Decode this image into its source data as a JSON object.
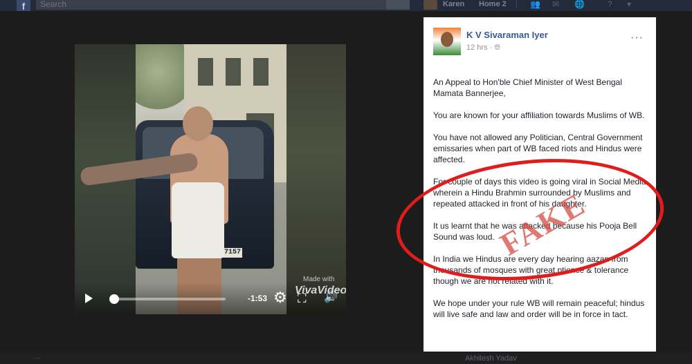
{
  "topbar": {
    "search_placeholder": "Search",
    "user_name": "Karen",
    "home_label": "Home",
    "home_count": "2"
  },
  "video": {
    "time_remaining": "-1:53",
    "watermark_top": "Made with",
    "watermark": "VivaVideo",
    "plate_text": "WB 7157"
  },
  "post": {
    "author": "K V Sivaraman Iyer",
    "timestamp": "12 hrs",
    "privacy_icon": "globe-icon",
    "paragraphs": [
      "An Appeal to Hon'ble Chief Minister of West Bengal Mamata Bannerjee,",
      "You are known for your affiliation towards Muslims of WB.",
      "You have not allowed any Politician, Central Government emissaries when part of WB faced riots and Hindus were affected.",
      "For couple of days this video is going viral in Social Media wherein a Hindu Brahmin surrounded by Muslims and repeated attacked in front of his daughter.",
      "It us learnt that he was attacked because his Pooja Bell Sound was loud.",
      "In India we Hindus are every day hearing aazan from thousands of mosques with great ptience & tolerance though we are not related with it.",
      "We hope under your rule WB will remain peaceful; hindus will live safe and law and order will be in force in tact."
    ]
  },
  "overlay": {
    "stamp": "FAKE",
    "circle_color": "#e01c1c"
  },
  "bottom": {
    "user": "Akhilesh Yadav"
  },
  "colors": {
    "link_blue": "#365899",
    "muted": "#90949c"
  }
}
